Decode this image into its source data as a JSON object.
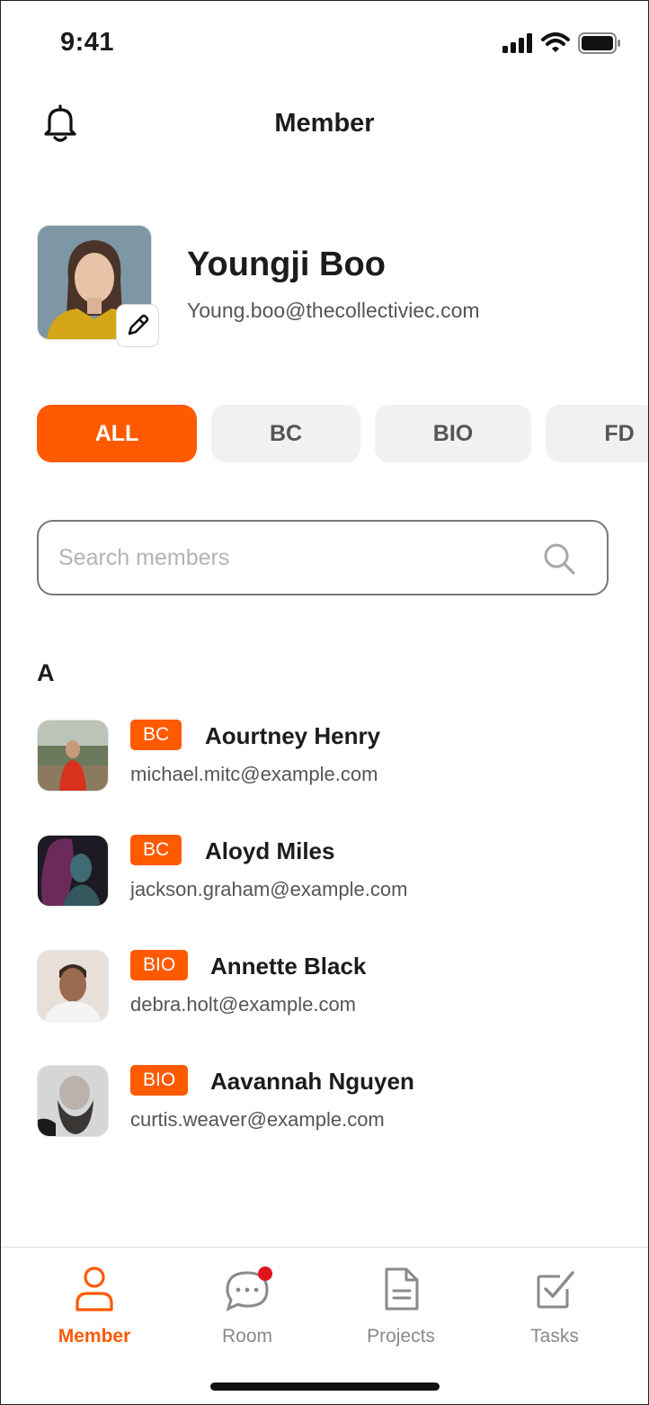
{
  "status_bar": {
    "time": "9:41"
  },
  "header": {
    "title": "Member"
  },
  "profile": {
    "name": "Youngji Boo",
    "email": "Young.boo@thecollectiviec.com"
  },
  "filters": [
    {
      "label": "ALL",
      "active": true
    },
    {
      "label": "BC",
      "active": false
    },
    {
      "label": "BIO",
      "active": false
    },
    {
      "label": "FD",
      "active": false
    }
  ],
  "search": {
    "placeholder": "Search members",
    "value": ""
  },
  "section": {
    "letter": "A"
  },
  "members": [
    {
      "tag": "BC",
      "name": "Aourtney Henry",
      "email": "michael.mitc@example.com"
    },
    {
      "tag": "BC",
      "name": "Aloyd Miles",
      "email": "jackson.graham@example.com"
    },
    {
      "tag": "BIO",
      "name": "Annette Black",
      "email": "debra.holt@example.com"
    },
    {
      "tag": "BIO",
      "name": "Aavannah Nguyen",
      "email": "curtis.weaver@example.com"
    }
  ],
  "tabbar": {
    "tabs": [
      {
        "label": "Member",
        "icon": "person-icon",
        "active": true
      },
      {
        "label": "Room",
        "icon": "chat-bubble-icon",
        "active": false,
        "notification_dot": true
      },
      {
        "label": "Projects",
        "icon": "document-icon",
        "active": false
      },
      {
        "label": "Tasks",
        "icon": "checkbox-icon",
        "active": false
      }
    ]
  },
  "colors": {
    "accent": "#ff5a00",
    "chip_inactive": "#f1f1f1",
    "text": "#1c1c1c",
    "muted": "#8a8a8a",
    "notification": "#e0141e"
  }
}
